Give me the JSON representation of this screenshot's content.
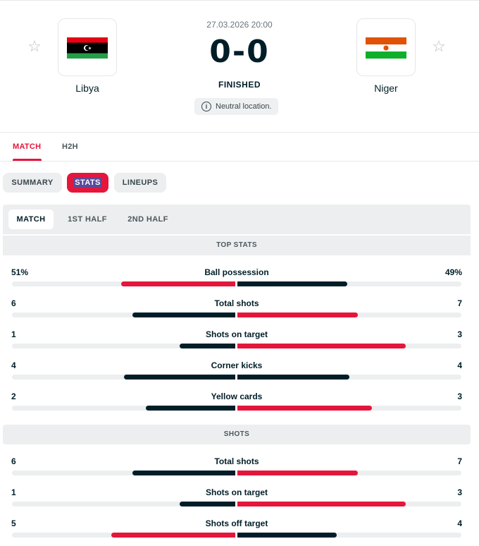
{
  "match": {
    "date": "27.03.2026 20:00",
    "score": "0-0",
    "status": "FINISHED",
    "venue_note": "Neutral location.",
    "home": {
      "name": "Libya",
      "flag": "libya-flag",
      "favorite_icon": "star-outline-icon"
    },
    "away": {
      "name": "Niger",
      "flag": "niger-flag",
      "favorite_icon": "star-outline-icon"
    }
  },
  "colors": {
    "accent": "#e4163c",
    "dark": "#001e28",
    "track": "#eceeef"
  },
  "tabs": [
    {
      "label": "MATCH",
      "active": true
    },
    {
      "label": "H2H",
      "active": false
    }
  ],
  "subtabs": [
    {
      "label": "SUMMARY",
      "active": false
    },
    {
      "label": "STATS",
      "active": true
    },
    {
      "label": "LINEUPS",
      "active": false
    }
  ],
  "periods": [
    {
      "label": "MATCH",
      "active": true
    },
    {
      "label": "1ST HALF",
      "active": false
    },
    {
      "label": "2ND HALF",
      "active": false
    }
  ],
  "sections": [
    {
      "title": "TOP STATS",
      "stats": [
        {
          "name": "Ball possession",
          "home": "51%",
          "away": "49%",
          "home_value": 51,
          "away_value": 49,
          "max": 100
        },
        {
          "name": "Total shots",
          "home": "6",
          "away": "7",
          "home_value": 6,
          "away_value": 7,
          "max": 13
        },
        {
          "name": "Shots on target",
          "home": "1",
          "away": "3",
          "home_value": 1,
          "away_value": 3,
          "max": 4
        },
        {
          "name": "Corner kicks",
          "home": "4",
          "away": "4",
          "home_value": 4,
          "away_value": 4,
          "max": 8
        },
        {
          "name": "Yellow cards",
          "home": "2",
          "away": "3",
          "home_value": 2,
          "away_value": 3,
          "max": 5
        }
      ]
    },
    {
      "title": "SHOTS",
      "stats": [
        {
          "name": "Total shots",
          "home": "6",
          "away": "7",
          "home_value": 6,
          "away_value": 7,
          "max": 13
        },
        {
          "name": "Shots on target",
          "home": "1",
          "away": "3",
          "home_value": 1,
          "away_value": 3,
          "max": 4
        },
        {
          "name": "Shots off target",
          "home": "5",
          "away": "4",
          "home_value": 5,
          "away_value": 4,
          "max": 9
        }
      ]
    }
  ]
}
